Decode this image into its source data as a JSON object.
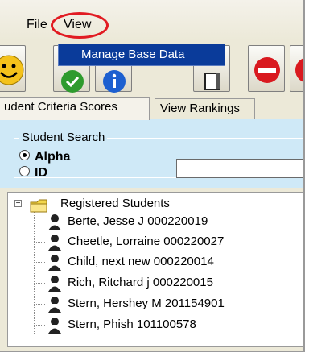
{
  "menu": {
    "file_label": "File",
    "view_label": "View"
  },
  "dropdown": {
    "items": [
      "Manage Base Data"
    ]
  },
  "toolbar": {
    "buttons": [
      "smiley-icon",
      "check-icon",
      "info-icon",
      "door-icon",
      "stop-icon"
    ]
  },
  "tabs": [
    {
      "label": "udent Criteria Scores",
      "active": true
    },
    {
      "label": "View Rankings",
      "active": false
    }
  ],
  "search": {
    "legend": "Student Search",
    "options": [
      "Alpha",
      "ID"
    ],
    "selected": "Alpha",
    "value": ""
  },
  "tree": {
    "root_label": "Registered Students",
    "expander": "−",
    "students": [
      "Berte,  Jesse J 000220019",
      "Cheetle,  Lorraine  000220027",
      "Child,  next new  000220014",
      "Rich,  Ritchard j 000220015",
      "Stern,  Hershey M 201154901",
      "Stern,  Phish  101100578"
    ]
  },
  "colors": {
    "highlight_ring": "#e11b22",
    "menu_selection": "#0a3b9a",
    "search_panel": "#cfe9f7"
  }
}
